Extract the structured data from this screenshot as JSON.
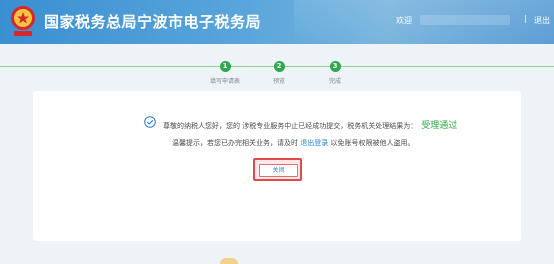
{
  "header": {
    "title": "国家税务总局宁波市电子税务局",
    "welcome": "欢迎",
    "separator": "|",
    "logout": "退出"
  },
  "steps": [
    {
      "number": "1",
      "label": "填写申请表"
    },
    {
      "number": "2",
      "label": "预览"
    },
    {
      "number": "3",
      "label": "完成"
    }
  ],
  "result": {
    "message": "尊敬的纳税人您好，您的 涉税专业服务中止已经成功提交，税务机关处理结果为：",
    "status": "受理通过"
  },
  "tip": {
    "prefix": "温馨提示，若您已办完相关业务，请及时",
    "link": "退出登录",
    "suffix": "以免账号权限被他人盗用。"
  },
  "close_button": "关闭",
  "colors": {
    "header": "#3a8fd1",
    "success": "#2ea84a",
    "link": "#2a7fd1",
    "highlight": "#e24a4a"
  }
}
